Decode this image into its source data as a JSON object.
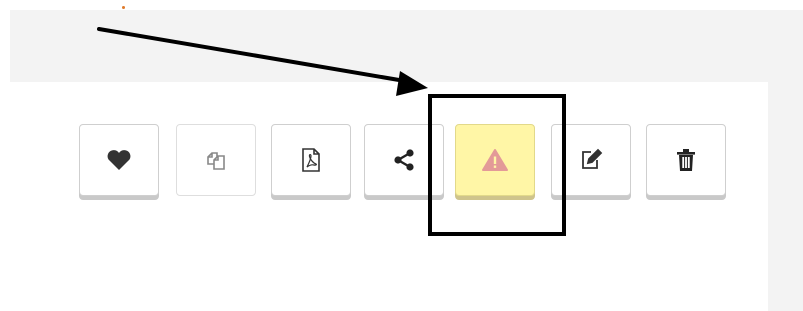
{
  "toolbar": {
    "buttons": [
      {
        "name": "favorite-button",
        "icon": "heart-icon"
      },
      {
        "name": "copy-button",
        "icon": "copy-icon",
        "state": "disabled"
      },
      {
        "name": "pdf-button",
        "icon": "pdf-file-icon"
      },
      {
        "name": "share-button",
        "icon": "share-icon"
      },
      {
        "name": "report-button",
        "icon": "warning-icon",
        "state": "highlighted"
      },
      {
        "name": "edit-button",
        "icon": "edit-icon"
      },
      {
        "name": "delete-button",
        "icon": "trash-icon"
      }
    ]
  },
  "annotation": {
    "arrow": "points-to-report-button",
    "box": "highlights-report-button"
  },
  "colors": {
    "warning_background": "#fff6a6",
    "warning_icon": "#e39a98",
    "annotation": "#000000"
  }
}
